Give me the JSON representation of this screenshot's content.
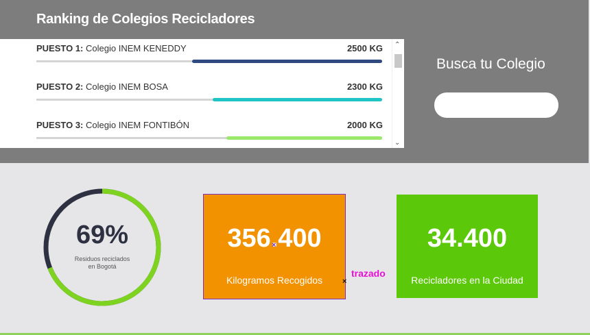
{
  "header": {
    "title": "Ranking de Colegios Recicladores"
  },
  "ranking": [
    {
      "position": "PUESTO 1:",
      "school": "Colegio INEM KENEDDY",
      "kg": "2500 KG",
      "fraction": 0.55,
      "color": "#2e4a80"
    },
    {
      "position": "PUESTO 2:",
      "school": "Colegio INEM BOSA",
      "kg": "2300 KG",
      "fraction": 0.49,
      "color": "#1fc4c4"
    },
    {
      "position": "PUESTO 3:",
      "school": "Colegio INEM FONTIBÓN",
      "kg": "2000 KG",
      "fraction": 0.45,
      "color": "#9be86a"
    }
  ],
  "search": {
    "title": "Busca tu Colegio",
    "placeholder": ""
  },
  "stats": {
    "recycled": {
      "percent_text": "69%",
      "value": 0.69,
      "label_line1": "Residuos reciclados",
      "label_line2": "en Bogotá"
    },
    "kilograms": {
      "value": "356.400",
      "label": "Kilogramos Recogidos"
    },
    "recyclers": {
      "value": "34.400",
      "label": "Recicladores en la Ciudad"
    }
  },
  "annotation": {
    "text": "trazado"
  },
  "colors": {
    "orange": "#f39200",
    "green": "#5cc80a",
    "ring_green": "#7ed321",
    "ring_dark": "#2e3142",
    "accent_magenta": "#e80fd5"
  }
}
